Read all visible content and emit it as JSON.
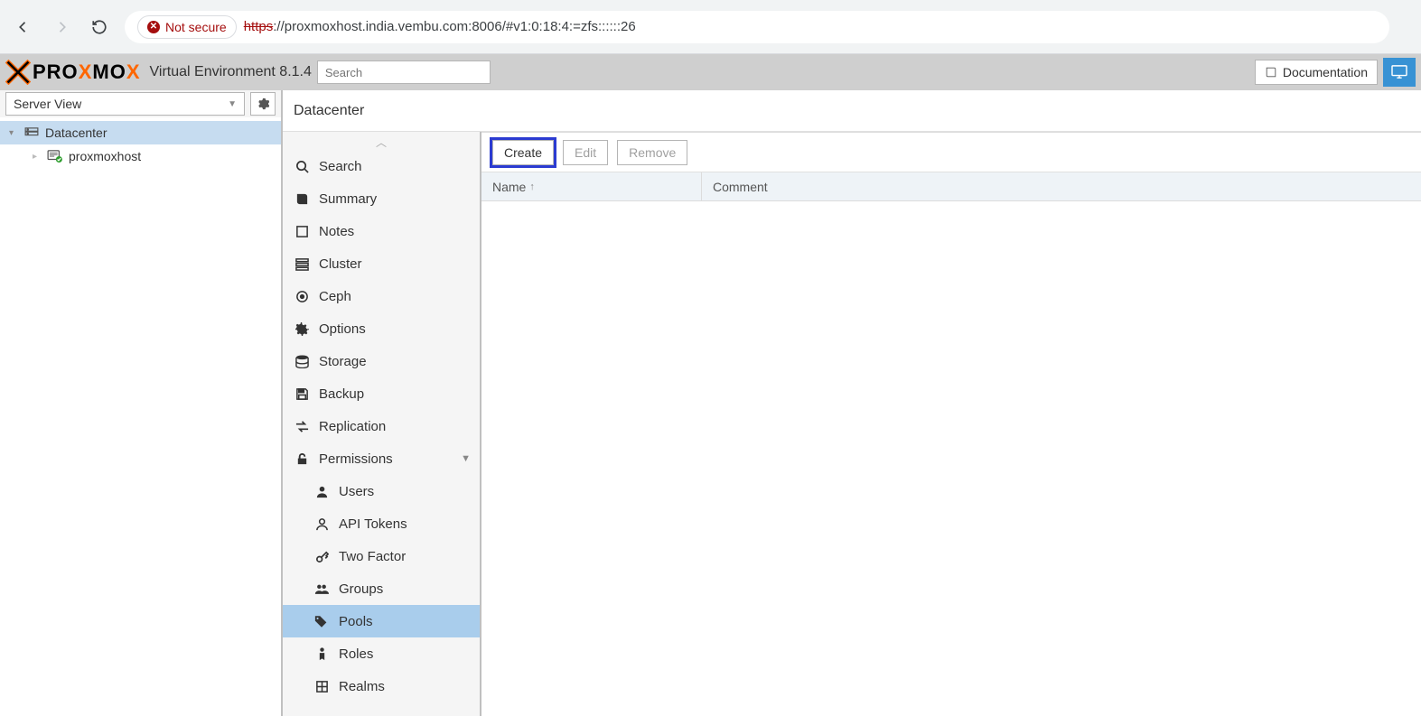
{
  "browser": {
    "not_secure_label": "Not secure",
    "url_protocol": "https",
    "url_rest": "://proxmoxhost.india.vembu.com:8006/#v1:0:18:4:=zfs::::::26"
  },
  "header": {
    "logo_text": "PROXMOX",
    "product": "Virtual Environment",
    "version": "8.1.4",
    "search_placeholder": "Search",
    "documentation_label": "Documentation"
  },
  "left": {
    "view_label": "Server View",
    "tree": {
      "datacenter": "Datacenter",
      "node": "proxmoxhost"
    }
  },
  "breadcrumb": "Datacenter",
  "cfg_nav": {
    "search": "Search",
    "summary": "Summary",
    "notes": "Notes",
    "cluster": "Cluster",
    "ceph": "Ceph",
    "options": "Options",
    "storage": "Storage",
    "backup": "Backup",
    "replication": "Replication",
    "permissions": "Permissions",
    "users": "Users",
    "api_tokens": "API Tokens",
    "two_factor": "Two Factor",
    "groups": "Groups",
    "pools": "Pools",
    "roles": "Roles",
    "realms": "Realms"
  },
  "toolbar": {
    "create": "Create",
    "edit": "Edit",
    "remove": "Remove"
  },
  "grid": {
    "col_name": "Name",
    "col_comment": "Comment"
  }
}
